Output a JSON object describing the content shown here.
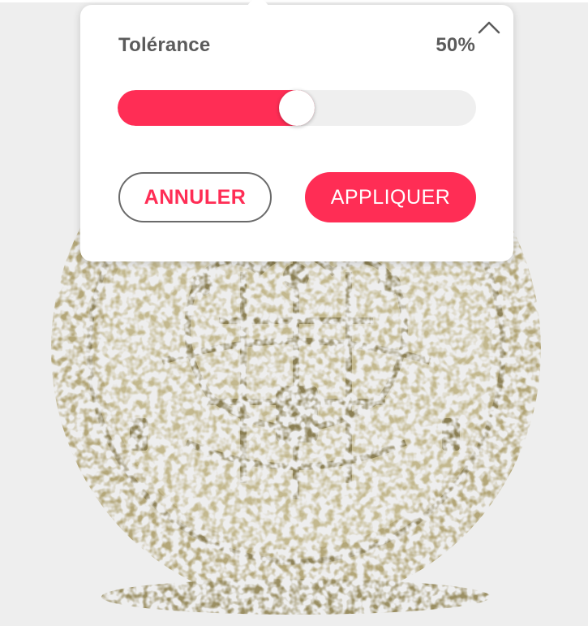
{
  "tolerance": {
    "label": "Tolérance",
    "value_text": "50%",
    "value": 0.5
  },
  "buttons": {
    "cancel": "ANNULER",
    "apply": "APPLIQUER"
  },
  "icons": {
    "collapse": "chevron-up-icon"
  },
  "colors": {
    "accent": "#ff2d55",
    "track": "#efefef",
    "coin": "#a89a6e",
    "background": "#eeeeee",
    "text": "#5b5b5b"
  }
}
